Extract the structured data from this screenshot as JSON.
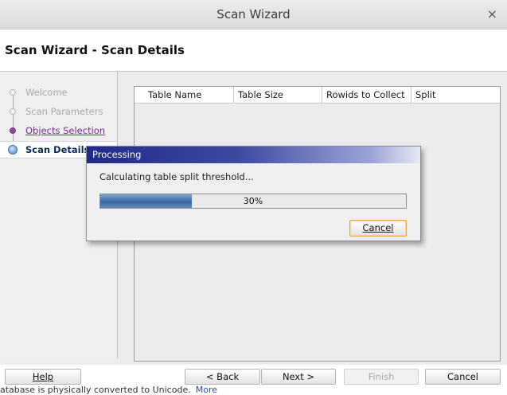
{
  "window": {
    "title": "Scan Wizard",
    "close_glyph": "×"
  },
  "header": {
    "heading": "Scan Wizard - Scan Details"
  },
  "steps": [
    {
      "label": "Welcome",
      "state": "disabled"
    },
    {
      "label": "Scan Parameters",
      "state": "disabled"
    },
    {
      "label": "Objects Selection",
      "state": "link"
    },
    {
      "label": "Scan Details",
      "state": "current"
    }
  ],
  "table": {
    "columns": [
      "Table Name",
      "Table Size",
      "Rowids to Collect",
      "Split"
    ]
  },
  "buttons": {
    "help": "Help",
    "back": "< Back",
    "next": "Next >",
    "finish": "Finish",
    "cancel": "Cancel"
  },
  "status": {
    "text": "atabase is physically converted to Unicode.",
    "more": "More"
  },
  "dialog": {
    "title": "Processing",
    "message": "Calculating table split threshold...",
    "progress_percent": 30,
    "progress_label": "30%",
    "cancel_label": "Cancel"
  }
}
